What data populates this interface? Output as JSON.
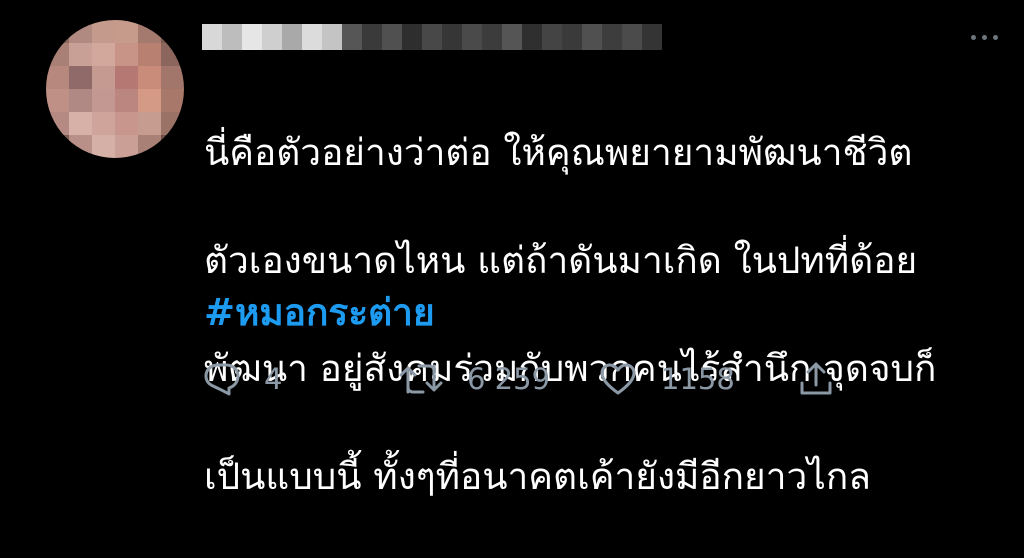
{
  "tweet": {
    "author_name": "",
    "author_handle": "",
    "text_lines": [
      "นี่คือตัวอย่างว่าต่อ ให้คุณพยายามพัฒนาชีวิต",
      "ตัวเองขนาดไหน แต่ถ้าดันมาเกิด ในปทที่ด้อย",
      "พัฒนา อยู่สังคมร่วมกับพวกคนไร้สำนึก จุดจบก็",
      "เป็นแบบนี้ ทั้งๆที่อนาคตเค้ายังมีอีกยาวไกล"
    ],
    "hashtag": "#หมอกระต่าย"
  },
  "actions": {
    "reply_icon": "reply-icon",
    "reply_count": "4",
    "retweet_icon": "retweet-icon",
    "retweet_count": "6 259",
    "like_icon": "heart-icon",
    "like_count": "1158",
    "share_icon": "share-icon"
  },
  "colors": {
    "background": "#000000",
    "text": "#ffffff",
    "link": "#1d9bf0",
    "muted": "#8b98a5"
  }
}
